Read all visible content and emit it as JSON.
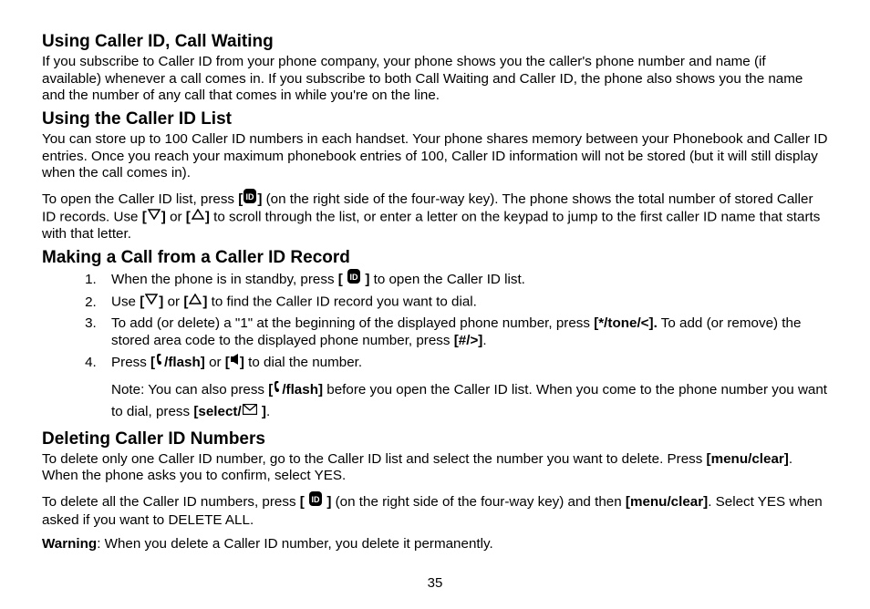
{
  "sections": {
    "s1": {
      "heading": "Using Caller ID, Call Waiting",
      "p1": "If you subscribe to Caller ID from your phone company, your phone shows you the caller's phone number and name (if available) whenever a call comes in. If you subscribe to both Call Waiting and Caller ID, the phone also shows you the name and the number of any call that comes in while you're on the line."
    },
    "s2": {
      "heading": "Using the Caller ID List",
      "p1": "You can store up to 100 Caller ID numbers in each handset. Your phone shares memory between your Phonebook and Caller ID entries. Once you reach your maximum phonebook entries of 100, Caller ID information will not be stored (but it will still display when the call comes in).",
      "p2a": "To open the Caller ID list, press ",
      "p2b": " (on the right side of the four-way key). The phone shows the total number of stored Caller ID records. Use ",
      "p2c": " or ",
      "p2d": " to scroll through the list, or enter a letter on the keypad to jump to the first caller ID name that starts with that letter."
    },
    "s3": {
      "heading": "Making a Call from a Caller ID Record",
      "li1a": "When the phone is in standby, press ",
      "li1b": " to open the Caller ID list.",
      "li2a": "Use ",
      "li2b": " or ",
      "li2c": " to find the Caller ID record you want to dial.",
      "li3a": "To add (or delete) a \"1\" at the beginning of the displayed phone number, press ",
      "li3key1": "[*/tone/<].",
      "li3b": " To add (or remove) the stored area code to the displayed phone number, press ",
      "li3key2": "[#/>]",
      "li3c": ".",
      "li4a": "Press ",
      "li4key1": "/flash]",
      "li4b": " or ",
      "li4c": " to dial the number.",
      "note_a": "Note: You can also press ",
      "note_key1": "/flash]",
      "note_b": " before you open the Caller ID list. When you come to the phone number you want to dial, press ",
      "note_key2": "[select/",
      "note_c": "."
    },
    "s4": {
      "heading": "Deleting Caller ID Numbers",
      "p1a": "To delete only one Caller ID number, go to the Caller ID list and select the number you want to delete. Press ",
      "p1key": "[menu/clear]",
      "p1b": ". When the phone asks you to confirm, select YES.",
      "p2a": "To delete all the Caller ID numbers, press ",
      "p2b": " (on the right side of the four-way key) and then ",
      "p2key": "[menu/clear]",
      "p2c": ". Select YES when asked if you want to DELETE ALL.",
      "p3a": "Warning",
      "p3b": ": When you delete a Caller ID number, you delete it permanently."
    }
  },
  "pageNumber": "35",
  "brackets": {
    "open": "[",
    "close": "]"
  }
}
